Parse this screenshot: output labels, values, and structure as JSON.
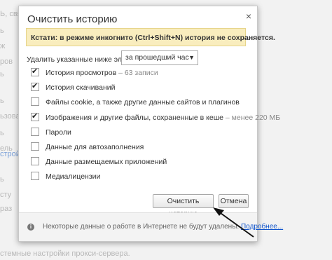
{
  "background": {
    "left_fragments": [
      "Ь, связа",
      "ь",
      "ж",
      "ров",
      "ь",
      "ь",
      "ьзовани",
      "ь",
      "ель",
      "стройте",
      "ь",
      "сту",
      "раз"
    ],
    "bottom_text": "стемные настройки прокси-сервера."
  },
  "dialog": {
    "title": "Очистить историю",
    "close_glyph": "×",
    "incognito_notice": "Кстати: в режиме инкогнито (Ctrl+Shift+N) история не сохраняется.",
    "range_label": "Удалить указанные ниже элементы",
    "range_value": "за прошедший час",
    "options": [
      {
        "label": "История просмотров",
        "note": "– 63 записи",
        "checked": true
      },
      {
        "label": "История скачиваний",
        "note": "",
        "checked": true
      },
      {
        "label": "Файлы cookie, а также другие данные сайтов и плагинов",
        "note": "",
        "checked": false
      },
      {
        "label": "Изображения и другие файлы, сохраненные в кеше",
        "note": "– менее 220 МБ",
        "checked": true
      },
      {
        "label": "Пароли",
        "note": "",
        "checked": false
      },
      {
        "label": "Данные для автозаполнения",
        "note": "",
        "checked": false
      },
      {
        "label": "Данные размещаемых приложений",
        "note": "",
        "checked": false
      },
      {
        "label": "Медиалицензии",
        "note": "",
        "checked": false
      }
    ],
    "clear_button": "Очистить историю",
    "cancel_button": "Отмена",
    "footer_text": "Некоторые данные о работе в Интернете не будут удалены.",
    "footer_link": "Подробнее..."
  }
}
